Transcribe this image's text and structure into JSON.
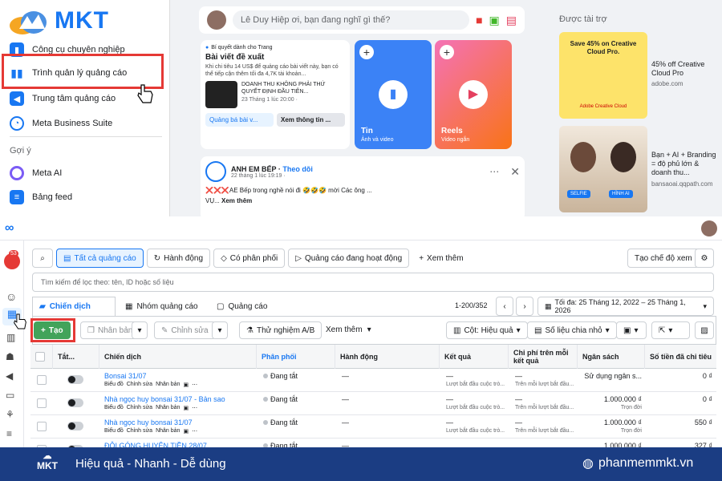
{
  "top": {
    "brand": "MKT",
    "sidebar": [
      {
        "label": "Công cụ chuyên nghiệp",
        "icon": "chart-icon"
      },
      {
        "label": "Trình quản lý quảng cáo",
        "icon": "bar-chart-icon"
      },
      {
        "label": "Trung tâm quảng cáo",
        "icon": "megaphone-icon"
      },
      {
        "label": "Meta Business Suite",
        "icon": "business-suite-icon"
      }
    ],
    "section_suggest": "Gợi ý",
    "suggest_items": [
      {
        "label": "Meta AI",
        "icon": "meta-ai-icon"
      },
      {
        "label": "Bảng feed",
        "icon": "feed-icon"
      }
    ],
    "composer_placeholder": "Lê Duy Hiệp ơi, bạn đang nghĩ gì thế?",
    "tip": {
      "small": "Bí quyết dành cho Trang",
      "title": "Bài viết đề xuất",
      "desc": "Khi chi tiêu 14 US$ để quảng cáo bài viết này, bạn có thể tiếp cận thêm tối đa 4,7K tài khoản...",
      "post_title": "DOANH THU KHÔNG PHẢI THỨ QUYẾT ĐỊNH ĐẦU TIÊN...",
      "post_date": "23 Tháng 1 lúc 20:00 · ",
      "btn_boost": "Quảng bá bài v...",
      "btn_insights": "Xem thông tin ..."
    },
    "story_blue": {
      "title": "Tin",
      "sub": "Ảnh và video"
    },
    "story_pink": {
      "title": "Reels",
      "sub": "Video ngắn"
    },
    "post": {
      "page": "ANH EM BẾP",
      "follow": "Theo dõi",
      "date": "22 tháng 1 lúc 19:19 · ",
      "text1": "❌❌❌AE Bếp trong nghề nói đi 🤣🤣🤣 mời Các ông ...",
      "text2": "VỤ...",
      "more": "Xem thêm"
    },
    "sponsored": "Được tài trợ",
    "ads": [
      {
        "img_title": "Save 45% on Creative Cloud Pro.",
        "img_sub": "Adobe Creative Cloud",
        "title": "45% off Creative Cloud Pro",
        "domain": "adobe.com"
      },
      {
        "img_label_1": "SELFIE",
        "img_label_2": "HÌNH AI",
        "title": "Bạn + AI + Branding = độ phủ lớn & doanh thu...",
        "domain": "bansaoai.qqpath.com"
      }
    ]
  },
  "ads_manager": {
    "notif_count": "53",
    "filter_chips": [
      "Tất cả quảng cáo",
      "Hành động",
      "Có phân phối",
      "Quảng cáo đang hoạt động"
    ],
    "see_more": "Xem thêm",
    "create_view": "Tạo chế độ xem",
    "search_placeholder": "Tìm kiếm để lọc theo: tên, ID hoặc số liệu",
    "tabs": [
      "Chiến dịch",
      "Nhóm quảng cáo",
      "Quảng cáo"
    ],
    "pagination": "1-200/352",
    "date_range": "Tối đa: 25 Tháng 12, 2022 – 25 Tháng 1, 2026",
    "toolbar": {
      "create": "Tạo",
      "duplicate": "Nhân bản",
      "edit": "Chỉnh sửa",
      "ab_test": "Thử nghiệm A/B",
      "more": "Xem thêm",
      "columns": "Cột: Hiệu quả",
      "breakdown": "Số liệu chia nhỏ"
    },
    "columns": [
      "Tắt...",
      "Chiến dịch",
      "Phân phối",
      "Hành động",
      "Kết quả",
      "Chi phí trên mỗi kết quả",
      "Ngân sách",
      "Số tiền đã chi tiêu"
    ],
    "row_actions": [
      "Biểu đồ",
      "Chỉnh sửa",
      "Nhân bản"
    ],
    "rows": [
      {
        "name": "Bonsai 31/07",
        "delivery": "Đang tắt",
        "action": "—",
        "result": "—",
        "result_sub": "Lượt bắt đầu cuộc trò...",
        "cost": "—",
        "cost_sub": "Trên mỗi lượt bắt đầu...",
        "budget": "Sử dụng ngân s...",
        "budget_sub": "",
        "spent": "0 ₫"
      },
      {
        "name": "Nhà ngọc huy bonsai 31/07 - Bản sao",
        "delivery": "Đang tắt",
        "action": "—",
        "result": "—",
        "result_sub": "Lượt bắt đầu cuộc trò...",
        "cost": "—",
        "cost_sub": "Trên mỗi lượt bắt đầu...",
        "budget": "1.000.000 ₫",
        "budget_sub": "Trọn đời",
        "spent": "0 ₫"
      },
      {
        "name": "Nhà ngọc huy bonsai 31/07",
        "delivery": "Đang tắt",
        "action": "—",
        "result": "—",
        "result_sub": "Lượt bắt đầu cuộc trò...",
        "cost": "—",
        "cost_sub": "Trên mỗi lượt bắt đầu...",
        "budget": "1.000.000 ₫",
        "budget_sub": "Trọn đời",
        "spent": "550 ₫"
      },
      {
        "name": "ĐỘI GÓNG HUYỆN TIỀN 28/07",
        "delivery": "Đang tắt",
        "action": "—",
        "result": "",
        "result_sub": "",
        "cost": "",
        "cost_sub": "",
        "budget": "1.000.000 ₫",
        "budget_sub": "",
        "spent": "327 ₫"
      }
    ]
  },
  "footer": {
    "logo": "MKT",
    "slogan": "Hiệu quả - Nhanh - Dễ dùng",
    "website": "phanmemmkt.vn"
  },
  "colors": {
    "accent": "#1877f2",
    "highlight": "#e53935",
    "create_green": "#42a35a",
    "footer_bg": "#1b3d83"
  }
}
